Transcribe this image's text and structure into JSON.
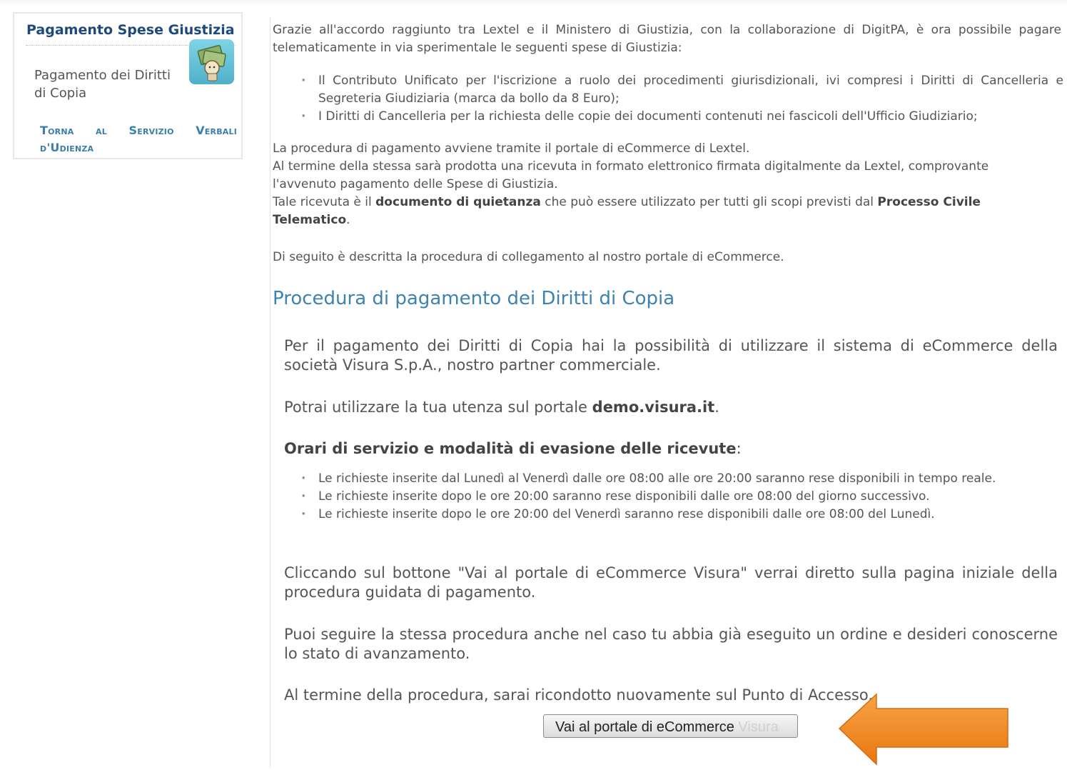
{
  "sidebar": {
    "title": "Pagamento Spese Giustizia",
    "icon": "money-icon",
    "link_text": "Pagamento dei Diritti di Copia",
    "back_link": "Torna al Servizio Verbali d'Udienza"
  },
  "intro": {
    "text": "Grazie all'accordo raggiunto tra Lextel e il Ministero di Giustizia, con la collaborazione di DigitPA, è ora possibile pagare telematicamente in via sperimentale le seguenti spese di Giustizia:",
    "bullets": [
      "Il Contributo Unificato per l'iscrizione a ruolo dei procedimenti giurisdizionali, ivi compresi i Diritti di Cancelleria e Segreteria Giudiziaria (marca da bollo da 8 Euro);",
      "I Diritti di Cancelleria per la richiesta delle copie dei documenti contenuti nei fascicoli dell'Ufficio Giudiziario;"
    ],
    "procedure_line": "La procedura di pagamento avviene tramite il portale di eCommerce di Lextel.",
    "receipt_line": "Al termine della stessa sarà prodotta una ricevuta in formato elettronico firmata digitalmente da Lextel, comprovante l'avvenuto pagamento delle Spese di Giustizia.",
    "receipt_pre": "Tale ricevuta è il ",
    "receipt_bold1": "documento di quietanza",
    "receipt_mid": " che può essere utilizzato per tutti gli scopi previsti dal ",
    "receipt_bold2": "Processo Civile Telematico",
    "receipt_end": ".",
    "description_line": "Di seguito è descritta la procedura di collegamento al nostro portale di eCommerce."
  },
  "section": {
    "heading": "Procedura di pagamento dei Diritti di Copia",
    "para1": "Per il pagamento dei Diritti di Copia hai la possibilità di utilizzare il sistema di eCommerce della società Visura S.p.A., nostro partner commerciale.",
    "para2_pre": "Potrai utilizzare la tua utenza sul portale ",
    "para2_bold": "demo.visura.it",
    "para2_end": ".",
    "hours_heading": "Orari di servizio e modalità di evasione delle ricevute",
    "hours_colon": ":",
    "hours": [
      "Le richieste inserite dal Lunedì al Venerdì dalle ore 08:00 alle ore 20:00 saranno rese disponibili in tempo reale.",
      "Le richieste inserite dopo le ore 20:00 saranno rese disponibili dalle ore 08:00 del giorno successivo.",
      "Le richieste inserite dopo le ore 20:00 del Venerdì saranno rese disponibili dalle ore 08:00 del Lunedì."
    ],
    "para3": "Cliccando sul bottone \"Vai al portale di eCommerce Visura\" verrai diretto sulla pagina iniziale della procedura guidata di pagamento.",
    "para4": "Puoi seguire la stessa procedura anche nel caso tu abbia già eseguito un ordine e desideri conoscerne lo stato di avanzamento.",
    "para5": "Al termine della procedura, sarai ricondotto nuovamente sul Punto di Accesso."
  },
  "button": {
    "label": "Vai al portale di eCommerce",
    "label_faded": " Visura"
  },
  "colors": {
    "heading_blue": "#3c83b0",
    "title_navy": "#1d4a7a",
    "arrow_orange": "#f28a1e"
  }
}
